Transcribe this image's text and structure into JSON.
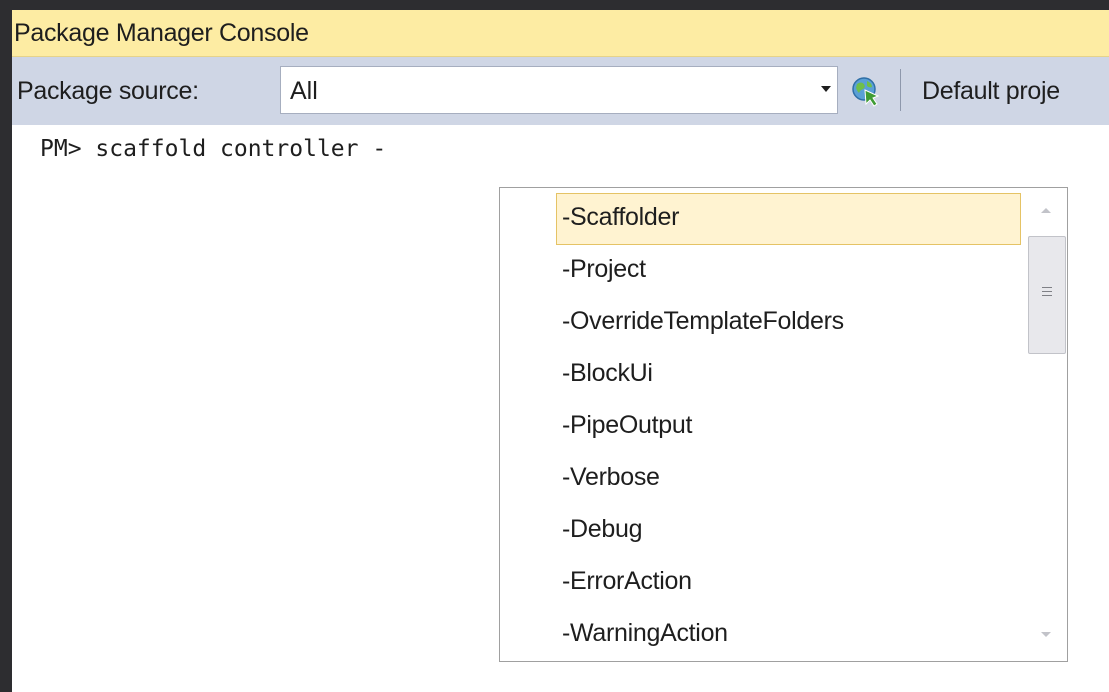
{
  "window": {
    "title": "Package Manager Console"
  },
  "toolbar": {
    "package_source_label": "Package source:",
    "package_source_value": "All",
    "default_project_label": "Default proje"
  },
  "console": {
    "prompt_line": "PM> scaffold controller -"
  },
  "completion": {
    "selected_index": 0,
    "items": [
      "-Scaffolder",
      "-Project",
      "-OverrideTemplateFolders",
      "-BlockUi",
      "-PipeOutput",
      "-Verbose",
      "-Debug",
      "-ErrorAction",
      "-WarningAction"
    ]
  },
  "colors": {
    "title_bar": "#fdeca3",
    "toolbar": "#cfd6e5",
    "selection_bg": "#fff3d1",
    "selection_border": "#e5c365"
  },
  "icons": {
    "refresh": "refresh-globe-icon"
  }
}
